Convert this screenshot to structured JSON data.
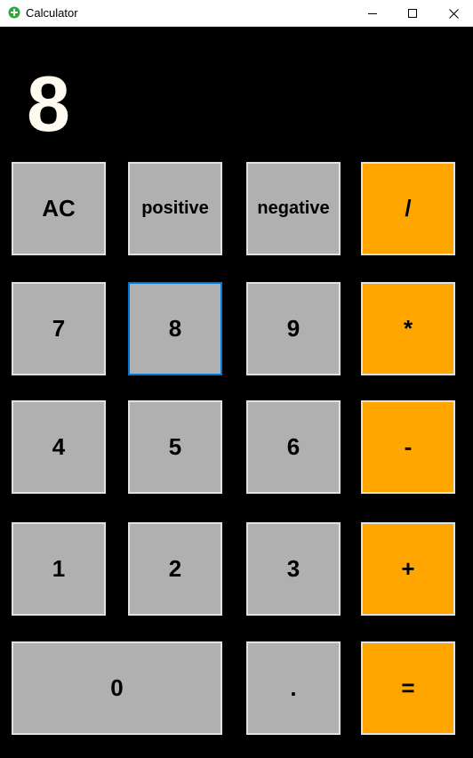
{
  "window": {
    "title": "Calculator",
    "app_icon": "green-plus-circle-icon",
    "controls": [
      "minimize-icon",
      "maximize-icon",
      "close-icon"
    ]
  },
  "display": {
    "value": "8"
  },
  "keys": {
    "ac": "AC",
    "positive": "positive",
    "negative": "negative",
    "divide": "/",
    "seven": "7",
    "eight": "8",
    "nine": "9",
    "multiply": "*",
    "four": "4",
    "five": "5",
    "six": "6",
    "subtract": "-",
    "one": "1",
    "two": "2",
    "three": "3",
    "add": "+",
    "zero": "0",
    "decimal": ".",
    "equals": "="
  },
  "state": {
    "focused_key": "8"
  },
  "colors": {
    "background": "#000000",
    "number_key": "#b0b0b0",
    "operator_key": "#ffa500",
    "key_border": "#e1e1e1",
    "focus_border": "#0078d7",
    "display_text": "#fffaf0"
  }
}
